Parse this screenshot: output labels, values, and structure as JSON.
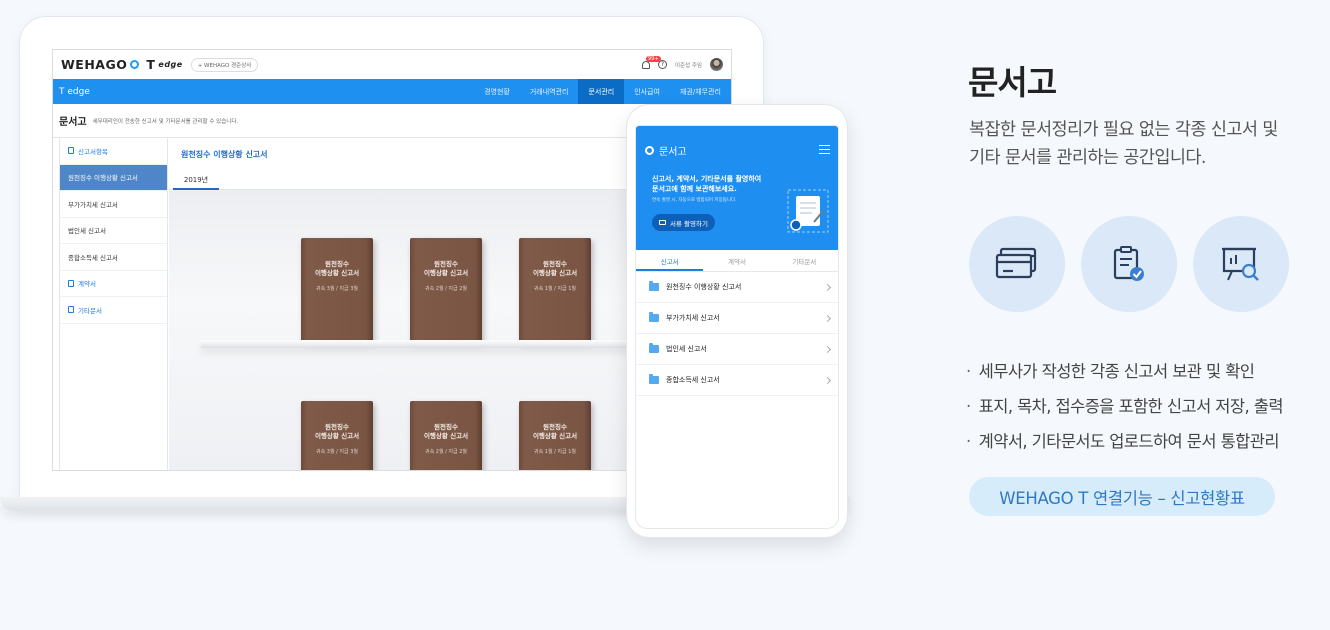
{
  "app": {
    "logo_text": "WEHAGO",
    "logo_t": "T",
    "logo_edge": "edge",
    "company": "+ WEHAGO 경준상사",
    "badge": "99+",
    "user": "이준섭 주임",
    "nav_title": "T edge",
    "nav_items": [
      "경영현황",
      "거래내역관리",
      "문서관리",
      "인사급여",
      "재권/채무관리"
    ],
    "page_title": "문서고",
    "page_desc": "세무대리인이 전송한 신고서 및 기타문서를 관리할 수 있습니다.",
    "sidebar": [
      {
        "label": "신고서항목",
        "type": "group"
      },
      {
        "label": "원천징수 이행상황 신고서",
        "type": "active"
      },
      {
        "label": "부가가치세 신고서",
        "type": "item"
      },
      {
        "label": "법인세 신고서",
        "type": "item"
      },
      {
        "label": "종합소득세 신고서",
        "type": "item"
      },
      {
        "label": "계약서",
        "type": "group"
      },
      {
        "label": "기타문서",
        "type": "group"
      }
    ],
    "content_title": "원천징수 이행상황 신고서",
    "year_tab": "2019년",
    "binder_title_1": "원천징수",
    "binder_title_2": "이행상황 신고서",
    "binders_top": [
      "귀속 3월 / 지급 3월",
      "귀속 2월 / 지급 2월",
      "귀속 1월 / 지급 1월"
    ],
    "binders_bottom": [
      "귀속 3월 / 지급 3월",
      "귀속 2월 / 지급 2월",
      "귀속 1월 / 지급 1월"
    ]
  },
  "phone": {
    "title": "문서고",
    "hero_line1": "신고서, 계약서, 기타문서를 촬영하여",
    "hero_line2": "문서고에 함께 보관해보세요.",
    "note": "연속 촬영 시, 자동으로 병합되어 저장됩니다.",
    "button": "서류 촬영하기",
    "tabs": [
      "신고서",
      "계약서",
      "기타문서"
    ],
    "rows": [
      "원천징수 이행상황 신고서",
      "부가가치세 신고서",
      "법인세 신고서",
      "종합소득세 신고서"
    ]
  },
  "panel": {
    "title": "문서고",
    "desc_line1": "복잡한 문서정리가 필요 없는 각종 신고서 및",
    "desc_line2": "기타 문서를 관리하는 공간입니다.",
    "icons": [
      "card-icon",
      "document-check-icon",
      "presentation-search-icon"
    ],
    "bullets": [
      "세무사가 작성한 각종 신고서 보관 및 확인",
      "표지, 목차, 접수증을 포함한 신고서 저장, 출력",
      "계약서, 기타문서도 업로드하여 문서 통합관리"
    ],
    "link_pill": "WEHAGO T 연결기능 – 신고현황표"
  },
  "colors": {
    "brand_blue": "#1e90f0",
    "nav_active": "#0b6cc5",
    "binder_brown": "#7a5543",
    "pill_bg": "#d6ecfb",
    "pill_text": "#2f78c4",
    "icon_circle": "#dbe8f7"
  }
}
